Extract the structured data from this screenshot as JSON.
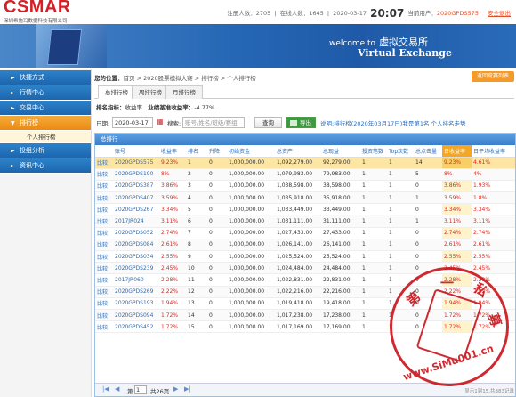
{
  "header": {
    "logo": "CSMAR",
    "logo_sub": "深圳希施玛数据科技有限公司",
    "registered_label": "注册人数：",
    "registered_count": "2705",
    "online_label": "在线人数：",
    "online_count": "1645",
    "date": "2020-03-17",
    "clock": "20:07",
    "user_label": "当前用户：",
    "user": "2020GPDS575",
    "logout": "安全退出"
  },
  "banner": {
    "welcome": "welcome to",
    "welcome_cn": "虚拟交易所",
    "title_en": "Virtual Exchange"
  },
  "sidebar": {
    "items": [
      {
        "label": "快捷方式"
      },
      {
        "label": "行情中心"
      },
      {
        "label": "交易中心"
      },
      {
        "label": "排行榜"
      },
      {
        "label": "投组分析"
      },
      {
        "label": "资讯中心"
      }
    ],
    "sub_active": "个人排行榜"
  },
  "breadcrumb": {
    "label": "您的位置：",
    "path": "首页 > 2020股票模拟大赛 > 排行榜 > 个人排行榜"
  },
  "back_button": "返回竞赛列表",
  "tabs": [
    {
      "label": "总排行榜"
    },
    {
      "label": "周排行榜"
    },
    {
      "label": "月排行榜"
    }
  ],
  "rank_info": {
    "metric_label": "排名指标：",
    "metric": "收益率",
    "target_label": "业绩基准收益率：",
    "target": "-4.77%"
  },
  "filters": {
    "date_label": "日期:",
    "date": "2020-03-17",
    "search_label": "搜索:",
    "search_placeholder": "账号/姓名/班级/赛组",
    "query_btn": "查询",
    "export_btn": "导出",
    "hint": "说明:排行榜(2020年03月17日)我是第1名   个人排名走势"
  },
  "panel_title": "总排行",
  "columns": [
    "",
    "账号",
    "收益率",
    "排名",
    "升降",
    "初始资金",
    "总资产",
    "总现益",
    "投资笔数",
    "Top次数",
    "总点击量",
    "日收益率",
    "日平均收益率"
  ],
  "rows": [
    [
      "比较",
      "2020GPDS575",
      "9.23%",
      "1",
      "0",
      "1,000,000.00",
      "1,092,279.00",
      "92,279.00",
      "1",
      "1",
      "14",
      "9.23%",
      "4.61%"
    ],
    [
      "比较",
      "2020GPDS190",
      "8%",
      "2",
      "0",
      "1,000,000.00",
      "1,079,983.00",
      "79,983.00",
      "1",
      "1",
      "5",
      "8%",
      "4%"
    ],
    [
      "比较",
      "2020GPDS387",
      "3.86%",
      "3",
      "0",
      "1,000,000.00",
      "1,038,598.00",
      "38,598.00",
      "1",
      "1",
      "0",
      "3.86%",
      "1.93%"
    ],
    [
      "比较",
      "2020GPDS407",
      "3.59%",
      "4",
      "0",
      "1,000,000.00",
      "1,035,918.00",
      "35,918.00",
      "1",
      "1",
      "1",
      "3.59%",
      "1.8%"
    ],
    [
      "比较",
      "2020GPDS267",
      "3.34%",
      "5",
      "0",
      "1,000,000.00",
      "1,033,449.00",
      "33,449.00",
      "1",
      "1",
      "0",
      "3.34%",
      "3.34%"
    ],
    [
      "比较",
      "2017JR024",
      "3.11%",
      "6",
      "0",
      "1,000,000.00",
      "1,031,111.00",
      "31,111.00",
      "1",
      "1",
      "1",
      "3.11%",
      "3.11%"
    ],
    [
      "比较",
      "2020GPDS052",
      "2.74%",
      "7",
      "0",
      "1,000,000.00",
      "1,027,433.00",
      "27,433.00",
      "1",
      "1",
      "0",
      "2.74%",
      "2.74%"
    ],
    [
      "比较",
      "2020GPDS084",
      "2.61%",
      "8",
      "0",
      "1,000,000.00",
      "1,026,141.00",
      "26,141.00",
      "1",
      "1",
      "0",
      "2.61%",
      "2.61%"
    ],
    [
      "比较",
      "2020GPDS034",
      "2.55%",
      "9",
      "0",
      "1,000,000.00",
      "1,025,524.00",
      "25,524.00",
      "1",
      "1",
      "0",
      "2.55%",
      "2.55%"
    ],
    [
      "比较",
      "2020GPDS239",
      "2.45%",
      "10",
      "0",
      "1,000,000.00",
      "1,024,484.00",
      "24,484.00",
      "1",
      "1",
      "0",
      "2.45%",
      "2.45%"
    ],
    [
      "比较",
      "2017JR060",
      "2.28%",
      "11",
      "0",
      "1,000,000.00",
      "1,022,831.00",
      "22,831.00",
      "1",
      "1",
      "0",
      "2.28%",
      "2.28%"
    ],
    [
      "比较",
      "2020GPDS269",
      "2.22%",
      "12",
      "0",
      "1,000,000.00",
      "1,022,216.00",
      "22,216.00",
      "1",
      "1",
      "0",
      "2.22%",
      "2.22%"
    ],
    [
      "比较",
      "2020GPDS193",
      "1.94%",
      "13",
      "0",
      "1,000,000.00",
      "1,019,418.00",
      "19,418.00",
      "1",
      "1",
      "0",
      "1.94%",
      "1.94%"
    ],
    [
      "比较",
      "2020GPDS094",
      "1.72%",
      "14",
      "0",
      "1,000,000.00",
      "1,017,238.00",
      "17,238.00",
      "1",
      "1",
      "0",
      "1.72%",
      "1.72%"
    ],
    [
      "比较",
      "2020GPDS452",
      "1.72%",
      "15",
      "0",
      "1,000,000.00",
      "1,017,169.00",
      "17,169.00",
      "1",
      "1",
      "0",
      "1.72%",
      "1.72%"
    ]
  ],
  "pager": {
    "page_label": "第",
    "page": "1",
    "total_label": "共26页",
    "info": "显示1到15,共383记录"
  },
  "seal": {
    "chars": [
      "第",
      "一",
      "私",
      "募"
    ],
    "text": "www.SiMu001.cn"
  },
  "colors": {
    "accent_blue": "#2d82c9",
    "active_orange": "#f39a2b",
    "positive_red": "#e2261a",
    "seal_red": "#c9141b"
  }
}
